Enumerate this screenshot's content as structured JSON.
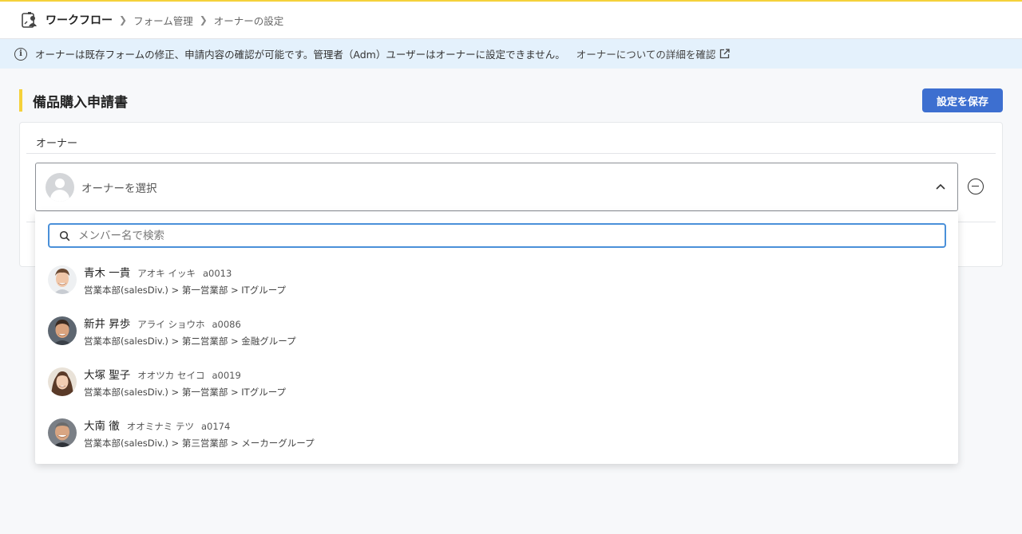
{
  "breadcrumb": {
    "root": "ワークフロー",
    "items": [
      "フォーム管理",
      "オーナーの設定"
    ]
  },
  "info": {
    "message": "オーナーは既存フォームの修正、申請内容の確認が可能です。管理者（Adm）ユーザーはオーナーに設定できません。",
    "link_label": "オーナーについての詳細を確認"
  },
  "page": {
    "title": "備品購入申請書",
    "save_label": "設定を保存"
  },
  "owner": {
    "section_label": "オーナー",
    "select_placeholder": "オーナーを選択"
  },
  "search": {
    "placeholder": "メンバー名で検索"
  },
  "members": [
    {
      "name": "青木 一貴",
      "kana": "アオキ イッキ",
      "id": "a0013",
      "dept": "営業本部(salesDiv.) > 第一営業部 > ITグループ"
    },
    {
      "name": "新井 昇歩",
      "kana": "アライ ショウホ",
      "id": "a0086",
      "dept": "営業本部(salesDiv.) > 第二営業部 > 金融グループ"
    },
    {
      "name": "大塚 聖子",
      "kana": "オオツカ セイコ",
      "id": "a0019",
      "dept": "営業本部(salesDiv.) > 第一営業部 > ITグループ"
    },
    {
      "name": "大南 徹",
      "kana": "オオミナミ テツ",
      "id": "a0174",
      "dept": "営業本部(salesDiv.) > 第三営業部 > メーカーグループ"
    }
  ],
  "colors": {
    "accent_yellow": "#f5d13a",
    "primary_button": "#3d6fd0",
    "info_background": "#e4f1fc",
    "search_focus": "#4a90d9"
  }
}
